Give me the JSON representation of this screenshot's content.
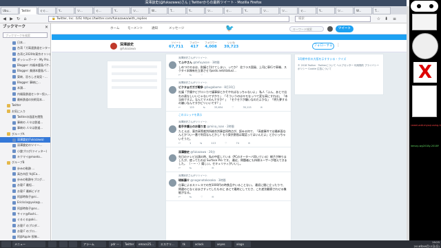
{
  "window": {
    "title": "深澤諒史(@fukazawa)さん | Twitterからの最新ツイート - Mozilla Firefox"
  },
  "tabs": [
    "Ubu...",
    "Twitter",
    "ぐぐ...",
    "Y...",
    "ツ...",
    "ぐ...",
    "Y...",
    "ツ...",
    "W...",
    "T...",
    "Y...",
    "ツ...",
    "ぐ...",
    "Y...",
    "ツ...",
    "ツ...",
    "ぐ...",
    "Y...",
    "ツ...",
    "W...",
    "T..."
  ],
  "navbar": {
    "url_site": "Twitter, Inc. (US)",
    "url": "https://twitter.com/fukazawa/with_replies",
    "search_placeholder": "検索"
  },
  "sidebar": {
    "title": "ブックマーク",
    "close": "×",
    "search_placeholder": "ブックマークを検索",
    "items": [
      "日本...",
      "台湾「ガ高速鉄道センター...",
      "台湾と2020年東京オリンピック...",
      "ダッシュボード - My Pro...",
      "Blogger: 内福本鹿島パケ...",
      "Blogger: 美顔本鹿島パ...",
      "東峡、恐ろしき発見・...",
      "Blogger: 事峡に...",
      "本頭...",
      "内福島鉄道センター投入...",
      "最新鉄道の技術見本...",
      "Twitter",
      "お気に入り",
      "Twitterの画面を閲覧",
      "事峡の 人々は鉄道...",
      "事峡の 人々は鉄道...",
      "グループA",
      "深澤論史(Fukazawa)",
      "深澤論史のツイー...",
      "小論ブログ(ツイッター)",
      "キクマイ@moeto...",
      "グループB",
      "歩みの軌跡 ...",
      "高台市民 YoJiCo...",
      "歩みの軌跡をブログ...",
      "お寝 F 最短...",
      "お寝 F 最新ビデオ",
      "阿部時和子@ni...",
      "Erickcia@yuka@...",
      "阿部時和子@ns...",
      "サイド@Roshi...",
      "ぐるぐる@aki...",
      "お寝 F のプロダ...",
      "お寝 F のブロ...",
      "阿部Apple 投稿...",
      "yahoo@voshocha..."
    ],
    "selected_index": 17
  },
  "twitter": {
    "nav": [
      "ホーム",
      "モーメント",
      "通知",
      "メッセージ"
    ],
    "search_placeholder": "キーワード検索",
    "tweet_button": "ツイート",
    "profile": {
      "name": "深澤諒史",
      "handle": "@fukazawa"
    },
    "stats": [
      {
        "label": "ツイート",
        "value": "67,711"
      },
      {
        "label": "フォロー",
        "value": "417"
      },
      {
        "label": "フォロワー",
        "value": "4,008"
      },
      {
        "label": "いいね",
        "value": "39,723"
      }
    ],
    "follow_button": "フォローする",
    "more": "⋮",
    "tweets": [
      {
        "retweet": "深澤諒史さんがリツイート",
        "name": "てふやさん",
        "handle": "@tefuyasan · 3時間",
        "body": "しめつけのまは、則議と引けてしまい、ってか？ 北ウラス国風、上司に車行で車端、スクタイ本稿有社立意させ fposts.net/status/...",
        "actions": "↩ ⇆ ♡"
      },
      {
        "retweet": "深澤諒史さんがリツイート",
        "name": "ビクタ@ガガガ戦争",
        "handle": "@bugabome · 8月10日",
        "body": "社議「手鏡やビゲロンカで議事録とかそやればなっちゃないよ」 私人「ふん、あとで出れの達なしいいじゃないですかり」 「そういうのはキモなっつて変な高にすれは」 「本当体ですよ。なんてマメのんですか？」 「セクセクが嫌いなのだよかな」 「明た夢するの嫌いなんですかビリいいです？」",
        "actions": "↩ 125 ⇆ 33,654 ♡ 35,115 ✉"
      },
      {
        "more": "このスレッドを表示"
      },
      {
        "retweet": "深澤諒史さんがリツイート",
        "name": "若手弁護士のお寝り言",
        "handle": "@mina_roan · 2時間",
        "body": "たとえば、東京高等裁判所総合判事会同時点が、読みる何で、「高裁事件では最新面なんとかつい一番で利用なんとかし？もう東京野昌は電話ってはいんだよ」とかいっちゃいそうだ。",
        "actions": "↩ 1 ⇆ 113 ♡ 74 ✉"
      },
      {
        "retweet": "",
        "name": "深澤諒史",
        "handle": "@fukazawa · 26分",
        "body": "先日のテレビ出演の時、私の中庭している（PCのオーターバ同いている）様子が映りましたが、使ってたのは Surface Pro です。 最近、問題者にも持帰ユーザーが増えてきました。 （・ー・）嬉しい。セキュリティがいいし。",
        "actions": "↩ ⇆ ♡ ✉"
      },
      {
        "retweet": "深澤諒史さんがリツイート",
        "name": "球新藤介",
        "handle": "@naganatokosaka · 3時間",
        "body": "仕事によるストレスでの完1000円の時食品やいることない。 最初に間に立ったりで、問違のとなくはまさすってしたものに あとで最終にしてださ、これ差別観察されせる機能がなる。",
        "actions": "↩ ⇆ ♡ ✉"
      }
    ],
    "right": {
      "link": "1同期中状の大阪を示すすいる・クイズ",
      "small": "© 2018 Twitter · Twitterについて ヘルプセンター 利用規約 プライバシーポリシー Cookie 広告について"
    }
  },
  "right_panel": {
    "label_red": "Lewel-add-mysql-using-h",
    "label_green": "kersxy-wg2018y-2018Y"
  },
  "taskbar": {
    "items": [
      "",
      "メニュー",
      "",
      "",
      "",
      "アラーム",
      "pdr — ...",
      "Twitter",
      "emacs25...",
      "エスケリ...",
      "tk",
      "xclock",
      "xeyes",
      "xlogo"
    ],
    "clock_time": "19:25",
    "clock_date": "2018年08月12日(日)"
  }
}
